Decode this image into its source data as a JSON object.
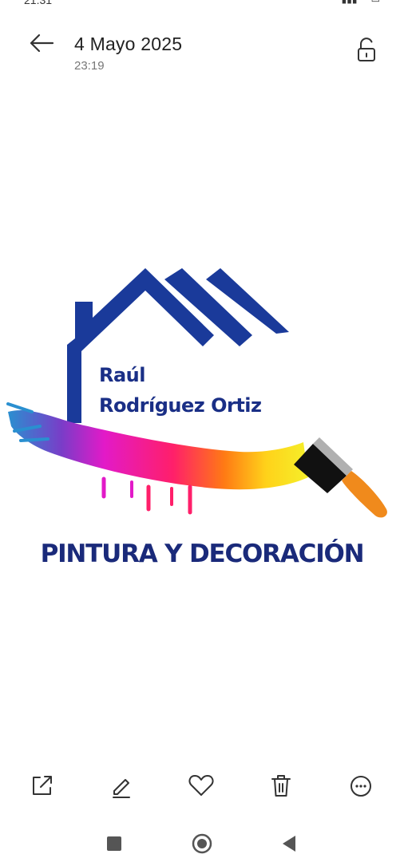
{
  "status": {
    "time": "21:31",
    "icons": [
      "signal-icon",
      "wifi-icon",
      "battery-icon"
    ]
  },
  "header": {
    "date": "4 Mayo 2025",
    "time": "23:19",
    "back_icon": "arrow-left-icon",
    "lock_icon": "unlock-icon"
  },
  "logo": {
    "name_line1": "Raúl",
    "name_line2": "Rodríguez Ortiz",
    "tagline": "PINTURA Y DECORACIÓN",
    "colors": {
      "blue": "#1a3a9a",
      "navy": "#1a2a7a"
    }
  },
  "actions": [
    "share-icon",
    "edit-icon",
    "favorite-icon",
    "delete-icon",
    "more-icon"
  ],
  "nav": [
    "recents-icon",
    "home-icon",
    "back-triangle-icon"
  ]
}
